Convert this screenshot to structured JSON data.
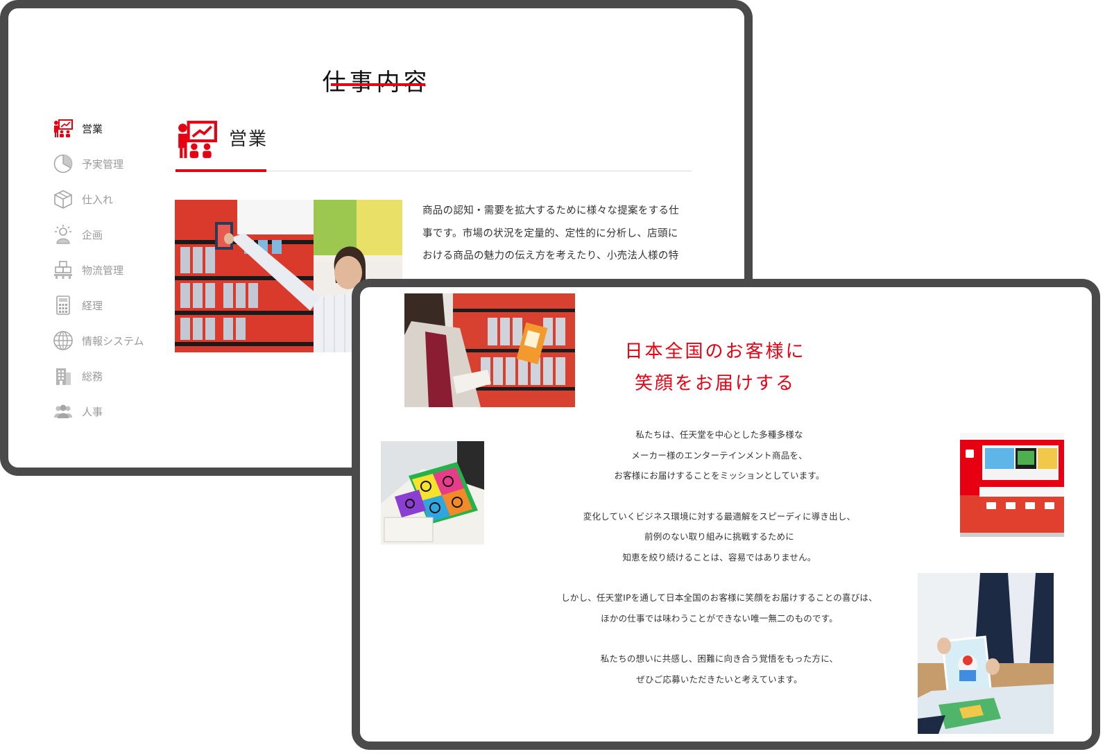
{
  "back_window": {
    "page_title": "仕事内容",
    "nav": [
      {
        "label": "営業",
        "icon": "presentation-icon",
        "active": true
      },
      {
        "label": "予実管理",
        "icon": "pie-chart-icon",
        "active": false
      },
      {
        "label": "仕入れ",
        "icon": "box-icon",
        "active": false
      },
      {
        "label": "企画",
        "icon": "idea-person-icon",
        "active": false
      },
      {
        "label": "物流管理",
        "icon": "stacked-boxes-icon",
        "active": false
      },
      {
        "label": "経理",
        "icon": "calculator-icon",
        "active": false
      },
      {
        "label": "情報システム",
        "icon": "globe-icon",
        "active": false
      },
      {
        "label": "総務",
        "icon": "building-icon",
        "active": false
      },
      {
        "label": "人事",
        "icon": "people-icon",
        "active": false
      }
    ],
    "section": {
      "title": "営業",
      "icon": "presentation-icon",
      "text_lines": [
        "商品の認知・需要を拡大するために様々な提案をする仕",
        "事です。市場の状況を定量的、定性的に分析し、店頭に",
        "おける商品の魅力の伝え方を考えたり、小売法人様の特"
      ]
    }
  },
  "front_window": {
    "headline": [
      "日本全国のお客様に",
      "笑顔をお届けする"
    ],
    "paragraphs": [
      [
        "私たちは、任天堂を中心とした多種多様な",
        "メーカー様のエンターテインメント商品を、",
        "お客様にお届けすることをミッションとしています。"
      ],
      [
        "変化していくビジネス環境に対する最適解をスピーディに導き出し、",
        "前例のない取り組みに挑戦するために",
        "知恵を絞り続けることは、容易ではありません。"
      ],
      [
        "しかし、任天堂IPを通して日本全国のお客様に笑顔をお届けすることの喜びは、",
        "ほかの仕事では味わうことができない唯一無二のものです。"
      ],
      [
        "私たちの想いに共感し、困難に向き合う覚悟をもった方に、",
        "ぜひご応募いただきたいと考えています。"
      ]
    ]
  },
  "colors": {
    "accent": "#e60012",
    "frame": "#4a4a4a",
    "muted": "#9a9a9a"
  }
}
